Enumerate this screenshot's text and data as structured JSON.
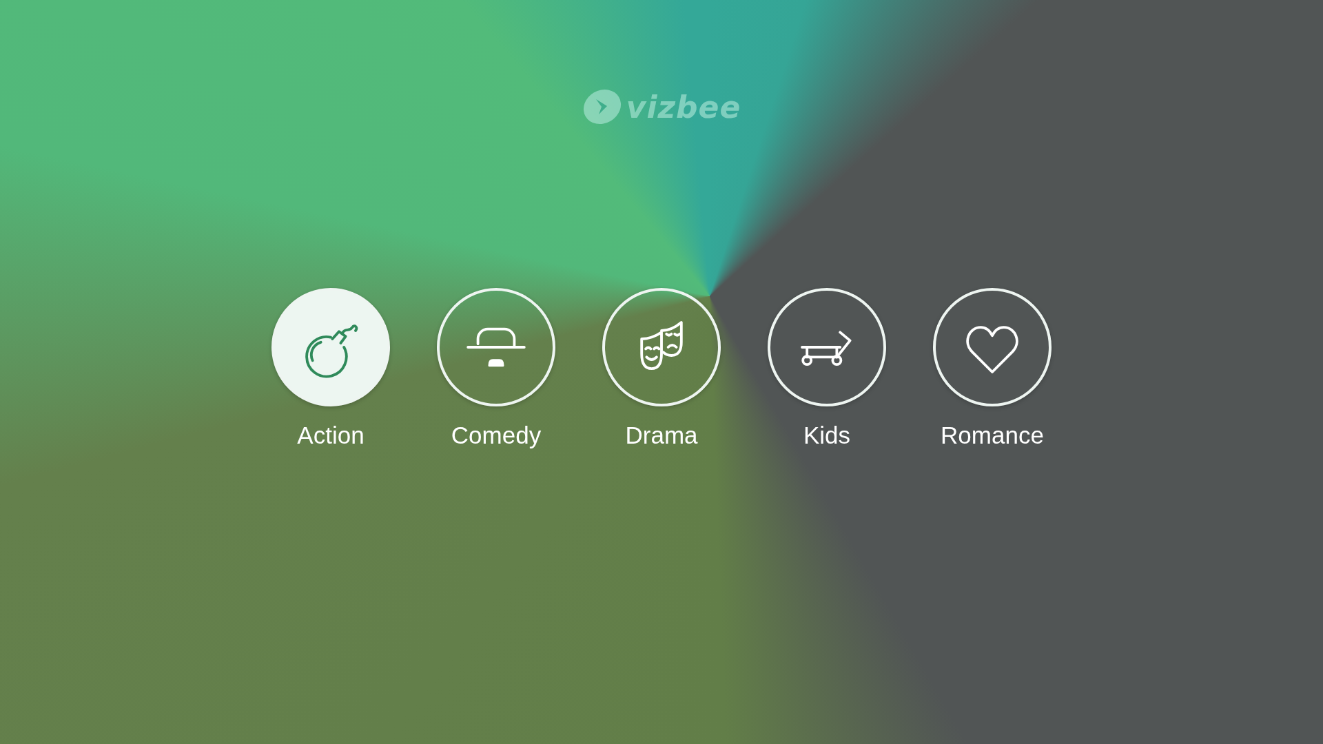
{
  "logo": {
    "text": "vizbee"
  },
  "genres": [
    {
      "kind": "bomb",
      "label": "Action",
      "selected": true
    },
    {
      "kind": "hat",
      "label": "Comedy",
      "selected": false
    },
    {
      "kind": "masks",
      "label": "Drama",
      "selected": false
    },
    {
      "kind": "wagon",
      "label": "Kids",
      "selected": false
    },
    {
      "kind": "heart",
      "label": "Romance",
      "selected": false
    }
  ]
}
